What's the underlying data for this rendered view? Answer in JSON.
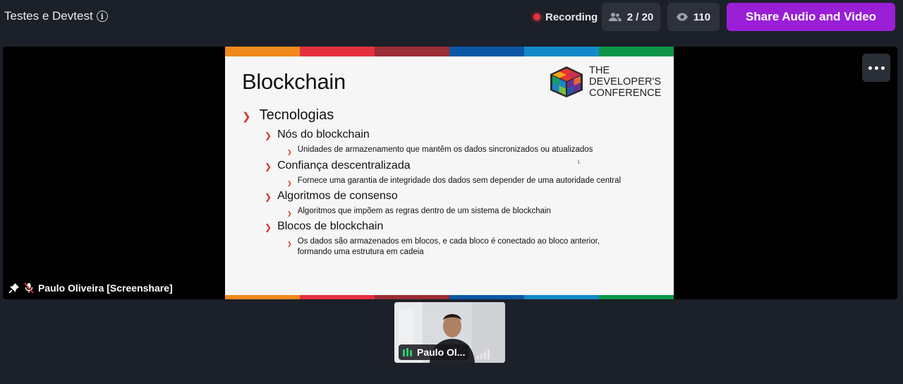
{
  "header": {
    "meeting_title": "Testes e Devtest",
    "info_icon": "info-icon",
    "recording_label": "Recording",
    "participants_count": "2 / 20",
    "viewers_count": "110",
    "share_button_label": "Share Audio and Video"
  },
  "stage": {
    "presenter_label": "Paulo Oliveira [Screenshare]",
    "more_icon": "more-horizontal-icon"
  },
  "slide": {
    "title": "Blockchain",
    "logo_lines": [
      "THE",
      "DEVELOPER'S",
      "CONFERENCE"
    ],
    "stripe_colors": [
      "#f0891c",
      "#e5313f",
      "#9b2d35",
      "#0b57a4",
      "#1489c8",
      "#0d9447"
    ],
    "items": [
      {
        "level": 1,
        "text": "Tecnologias"
      },
      {
        "level": 2,
        "text": "Nós do blockchain"
      },
      {
        "level": 3,
        "text": "Unidades de armazenamento que mantêm os dados sincronizados ou atualizados"
      },
      {
        "level": 2,
        "text": "Confiança descentralizada"
      },
      {
        "level": 3,
        "text": "Fornece uma garantia de integridade dos dados sem depender de uma autoridade central"
      },
      {
        "level": 2,
        "text": "Algoritmos de consenso"
      },
      {
        "level": 3,
        "text": "Algoritmos que impõem as regras dentro de um sistema de blockchain"
      },
      {
        "level": 2,
        "text": "Blocos de blockchain"
      },
      {
        "level": 3,
        "text": "Os dados são armazenados em blocos, e cada bloco é conectado ao bloco anterior, formando uma estrutura em cadeia"
      }
    ]
  },
  "camera": {
    "name_label": "Paulo Ol...",
    "mic_icon": "audio-level-icon",
    "signal_icon": "signal-strength-icon"
  },
  "colors": {
    "background": "#1c2029",
    "accent": "#9a1ed6",
    "recording_dot": "#e5323b",
    "bullet_arrow": "#d6332a"
  }
}
